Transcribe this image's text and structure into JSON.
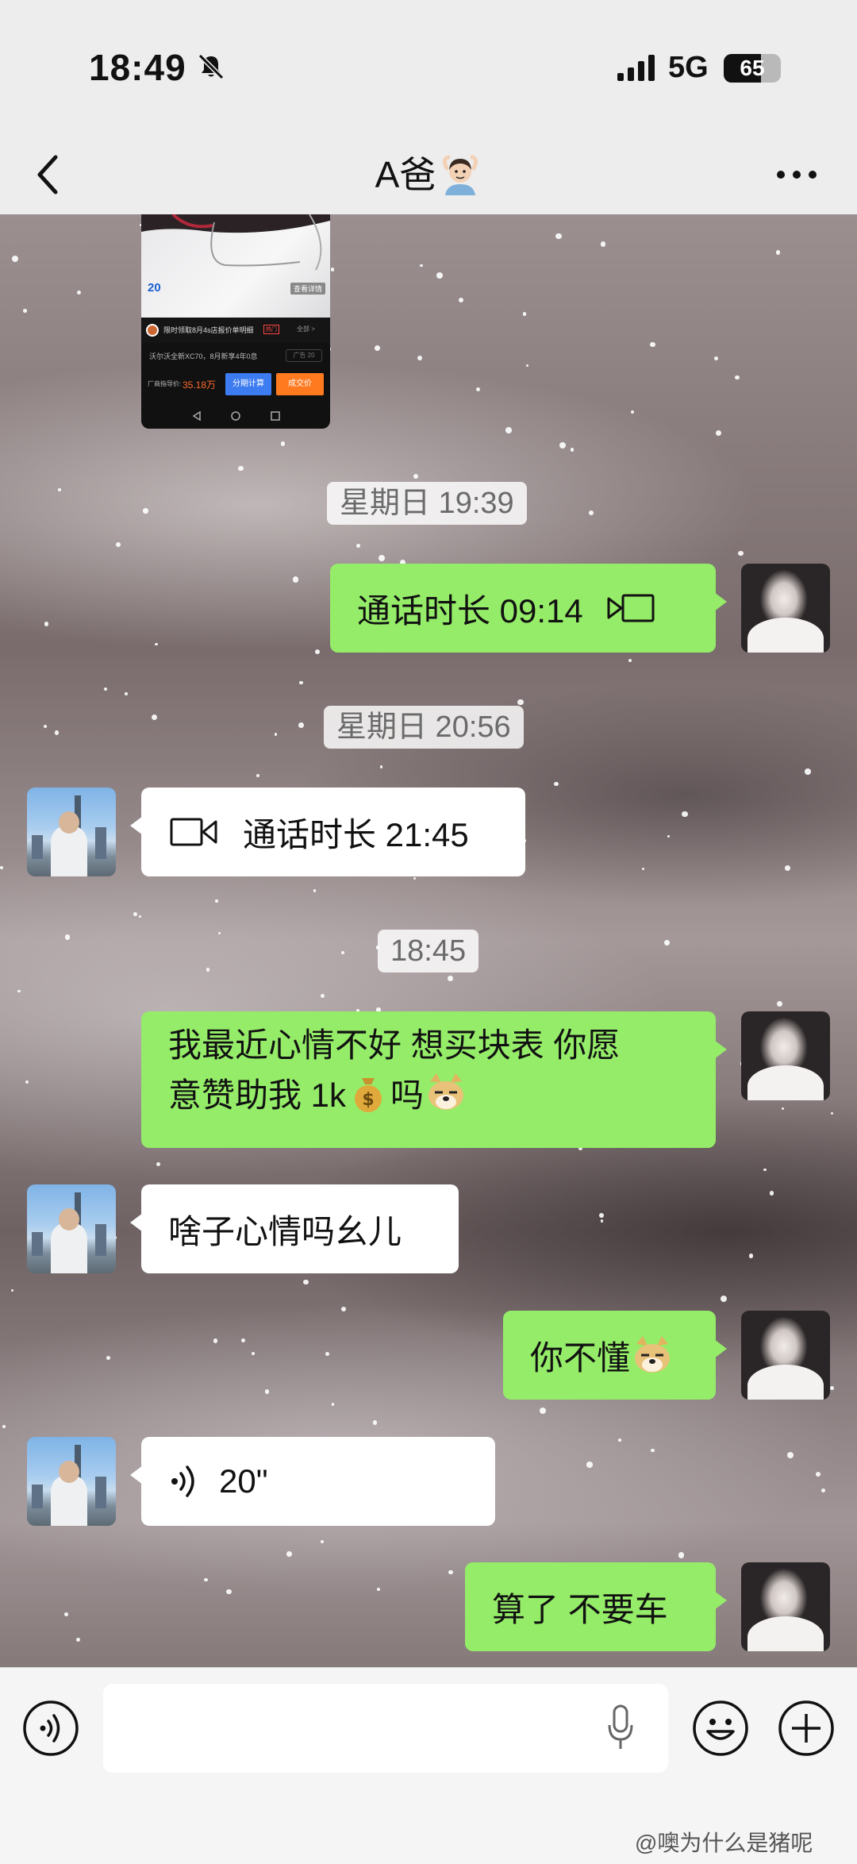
{
  "status_bar": {
    "time": "18:49",
    "network": "5G",
    "battery": "65",
    "battery_level": 0.65
  },
  "nav": {
    "title": "A爸"
  },
  "shared_screenshot": {
    "badge_number": "20",
    "tag": "查看详情",
    "offer_text": "限时领取8月4s店报价单明细",
    "hot": "热门",
    "all": "全部 >",
    "model_text": "沃尔沃全新XC70，8月新享4年0息",
    "box_text": "广告 20",
    "price_label": "厂商指导价:",
    "price": "35.18万",
    "btn1": "分期计算",
    "btn2": "成交价"
  },
  "messages": [
    {
      "type": "timestamp",
      "text": "星期日 19:39"
    },
    {
      "type": "call",
      "side": "me",
      "text": "通话时长 09:14"
    },
    {
      "type": "timestamp",
      "text": "星期日 20:56"
    },
    {
      "type": "call",
      "side": "other",
      "text": "通话时长 21:45"
    },
    {
      "type": "timestamp",
      "text": "18:45"
    },
    {
      "type": "text",
      "side": "me",
      "line1": "我最近心情不好 想买块表  你愿",
      "line2": "意赞助我 1k",
      "line2b": "吗"
    },
    {
      "type": "text",
      "side": "other",
      "text": "啥子心情吗幺儿"
    },
    {
      "type": "text",
      "side": "me",
      "text": "你不懂"
    },
    {
      "type": "voice",
      "side": "other",
      "duration": "20\""
    },
    {
      "type": "text",
      "side": "me",
      "text": "算了 不要车"
    }
  ],
  "watermark": "@噢为什么是猪呢",
  "icons": {
    "back": "chevron-left-icon",
    "more": "more-dots-icon",
    "voice_toggle": "voice-mode-icon",
    "mic": "microphone-icon",
    "emoji": "emoji-face-icon",
    "plus": "plus-circle-icon"
  },
  "colors": {
    "my_bubble": "#95ec69",
    "their_bubble": "#ffffff",
    "bar_bg": "#ededed"
  }
}
